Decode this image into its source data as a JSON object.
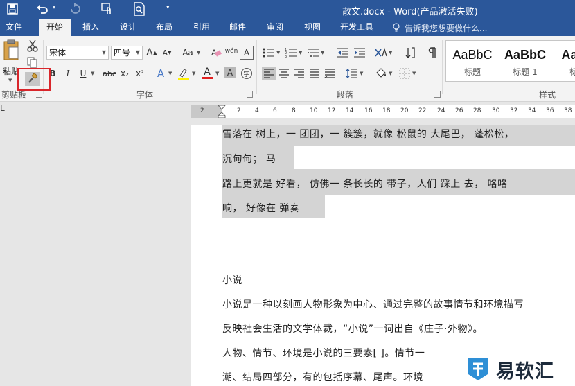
{
  "titlebar": {
    "title": "散文.docx - Word(产品激活失败)",
    "qat_more": "▾",
    "undo_arrow": "▾"
  },
  "tabs": [
    {
      "label": "文件"
    },
    {
      "label": "开始"
    },
    {
      "label": "插入"
    },
    {
      "label": "设计"
    },
    {
      "label": "布局"
    },
    {
      "label": "引用"
    },
    {
      "label": "邮件"
    },
    {
      "label": "审阅"
    },
    {
      "label": "视图"
    },
    {
      "label": "开发工具"
    }
  ],
  "tellme": "告诉我您想要做什么...",
  "clipboard": {
    "paste_label": "粘贴",
    "group_label": "剪贴板"
  },
  "font": {
    "name": "宋体",
    "size": "四号",
    "group_label": "字体",
    "grow": "A",
    "shrink": "A",
    "case": "Aa",
    "bold": "B",
    "italic": "I",
    "underline": "U",
    "strike": "abc",
    "sub": "x₂",
    "sup": "x²",
    "effects": "A",
    "color": "A",
    "shade": "A",
    "enclose": "字",
    "pinyin": "wén",
    "clear": "A"
  },
  "paragraph": {
    "group_label": "段落"
  },
  "styles": {
    "group_label": "样式",
    "items": [
      {
        "sample": "AaBbC",
        "name": "标题"
      },
      {
        "sample": "AaBbC",
        "name": "标题 1"
      },
      {
        "sample": "AaBb",
        "name": "标题"
      }
    ]
  },
  "ruler": {
    "ticks": [
      "2",
      "2",
      "4",
      "6",
      "8",
      "10",
      "12",
      "14",
      "16",
      "18",
      "20",
      "22",
      "24",
      "26",
      "28",
      "30",
      "32",
      "34",
      "36",
      "38"
    ]
  },
  "document": {
    "lines": [
      "雪落在 树上，一 团团，一 簇簇，就像 松鼠的 大尾巴， 蓬松松，",
      "沉甸甸； 马",
      "路上更就是 好看， 仿佛一 条长长的 带子，人们 踩上 去， 咯咯",
      "响， 好像在 弹奏",
      "小说",
      "小说是一种以刻画人物形象为中心、通过完整的故事情节和环境描写",
      "反映社会生活的文学体裁，“小说”一词出自《庄子·外物》。",
      "人物、情节、环境是小说的三要素[ ]。情节一",
      "潮、结局四部分，有的包括序幕、尾声。环境"
    ]
  },
  "watermark": {
    "text": "易软汇"
  },
  "corner": "L"
}
